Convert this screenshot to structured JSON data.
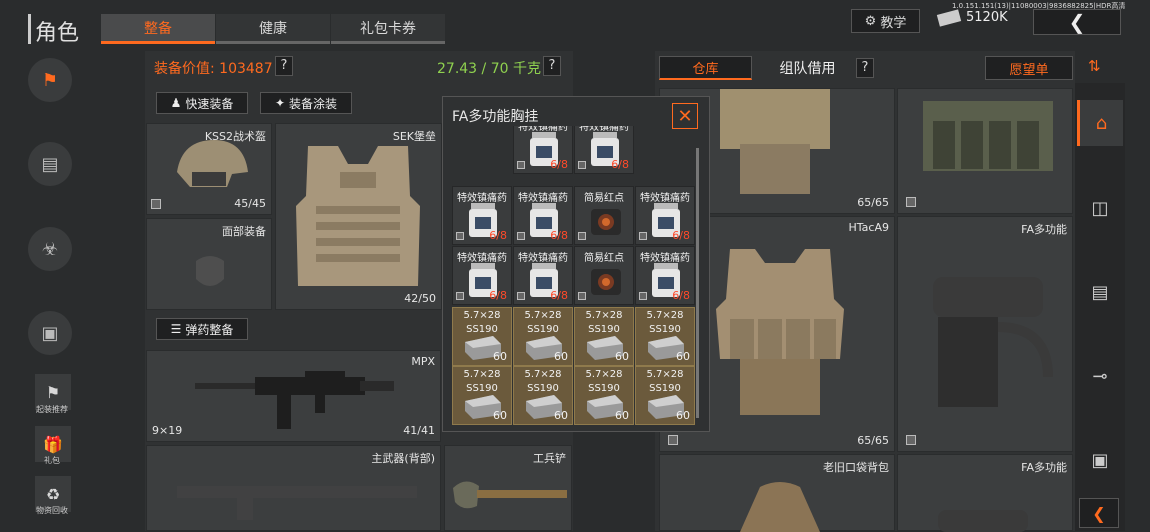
{
  "header": {
    "title": "角色",
    "tabs": [
      {
        "label": "整备",
        "active": true
      },
      {
        "label": "健康",
        "active": false
      },
      {
        "label": "礼包卡券",
        "active": false
      }
    ],
    "tutorial": "教学",
    "currency": "5120K",
    "version": "1.0.151.151(13)|11080003|9836882825|HDR高清"
  },
  "side": {
    "items": [
      {
        "label": "",
        "icon": "character-icon"
      },
      {
        "label": "",
        "icon": "backpack-icon"
      },
      {
        "label": "",
        "icon": "health-icon"
      },
      {
        "label": "",
        "icon": "case-icon"
      },
      {
        "label": "起装推荐",
        "icon": "recommend-icon"
      },
      {
        "label": "礼包",
        "icon": "gift-icon"
      },
      {
        "label": "物资回收",
        "icon": "recycle-icon"
      }
    ]
  },
  "loadout": {
    "value_label": "装备价值: 103487",
    "weight": "27.43 / 70 千克",
    "quick_equip": "快速装备",
    "paint": "装备涂装",
    "ammo_btn": "弹药整备",
    "helmet": {
      "name": "KSS2战术盔",
      "count": "45/45"
    },
    "armor": {
      "name": "SEK堡垒",
      "count": "42/50"
    },
    "face": {
      "name": "面部装备"
    },
    "gun": {
      "name": "MPX",
      "caliber": "9×19",
      "count": "41/41"
    },
    "primary_back": {
      "name": "主武器(背部)"
    },
    "shovel": {
      "name": "工兵铲"
    }
  },
  "popup": {
    "title": "FA多功能胸挂",
    "rows": [
      [
        {
          "n": "特效镇痛药",
          "c": "6/8"
        },
        {
          "n": "特效镇痛药",
          "c": "6/8"
        }
      ],
      [
        {
          "n": "特效镇痛药",
          "c": "6/8"
        },
        {
          "n": "特效镇痛药",
          "c": "6/8"
        },
        {
          "n": "简易红点",
          "c": ""
        },
        {
          "n": "特效镇痛药",
          "c": "6/8"
        }
      ],
      [
        {
          "n": "特效镇痛药",
          "c": "6/8"
        },
        {
          "n": "特效镇痛药",
          "c": "6/8"
        },
        {
          "n": "简易红点",
          "c": ""
        },
        {
          "n": "特效镇痛药",
          "c": "6/8"
        }
      ],
      [
        {
          "n": "5.7×28",
          "s": "SS190",
          "c": "60"
        },
        {
          "n": "5.7×28",
          "s": "SS190",
          "c": "60"
        },
        {
          "n": "5.7×28",
          "s": "SS190",
          "c": "60"
        },
        {
          "n": "5.7×28",
          "s": "SS190",
          "c": "60"
        }
      ],
      [
        {
          "n": "5.7×28",
          "s": "SS190",
          "c": "60"
        },
        {
          "n": "5.7×28",
          "s": "SS190",
          "c": "60"
        },
        {
          "n": "5.7×28",
          "s": "SS190",
          "c": "60"
        },
        {
          "n": "5.7×28",
          "s": "SS190",
          "c": "60"
        }
      ]
    ]
  },
  "storage": {
    "tabs": [
      {
        "label": "仓库"
      },
      {
        "label": "组队借用"
      }
    ],
    "wishlist": "愿望单",
    "items": [
      {
        "name": "",
        "count": "65/65"
      },
      {
        "name": "",
        "count": ""
      },
      {
        "name": "HTacA9",
        "count": "65/65"
      },
      {
        "name": "FA多功能",
        "count": ""
      },
      {
        "name": "老旧口袋背包",
        "count": ""
      },
      {
        "name": "FA多功能",
        "count": ""
      }
    ]
  },
  "colors": {
    "accent": "#ff6a1f",
    "weight": "#8fd14f"
  }
}
